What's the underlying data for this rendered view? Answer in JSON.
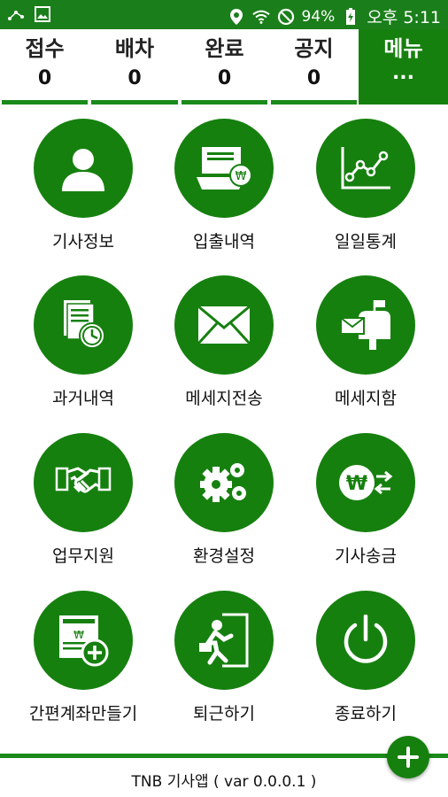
{
  "status_bar": {
    "battery": "94%",
    "time": "오후 5:11",
    "icons": [
      "signal-app-icon",
      "image-icon",
      "location-icon",
      "wifi-icon",
      "do-not-disturb-icon",
      "battery-charging-icon"
    ]
  },
  "tabs": [
    {
      "label": "접수",
      "count": "0"
    },
    {
      "label": "배차",
      "count": "0"
    },
    {
      "label": "완료",
      "count": "0"
    },
    {
      "label": "공지",
      "count": "0"
    },
    {
      "label": "메뉴",
      "count": "..."
    }
  ],
  "menu": [
    {
      "label": "기사정보",
      "icon": "person-icon"
    },
    {
      "label": "입출내역",
      "icon": "bill-won-icon"
    },
    {
      "label": "일일통계",
      "icon": "line-chart-icon"
    },
    {
      "label": "과거내역",
      "icon": "document-history-icon"
    },
    {
      "label": "메세지전송",
      "icon": "envelope-icon"
    },
    {
      "label": "메세지함",
      "icon": "mailbox-icon"
    },
    {
      "label": "업무지원",
      "icon": "handshake-icon"
    },
    {
      "label": "환경설정",
      "icon": "gears-icon"
    },
    {
      "label": "기사송금",
      "icon": "won-transfer-icon"
    },
    {
      "label": "간편계좌만들기",
      "icon": "account-add-icon"
    },
    {
      "label": "퇴근하기",
      "icon": "exit-door-icon"
    },
    {
      "label": "종료하기",
      "icon": "power-icon"
    }
  ],
  "footer": {
    "text": "TNB 기사앱 ( var 0.0.0.1 )"
  },
  "colors": {
    "primary": "#16800f",
    "accent_bar": "#1a8a1a",
    "background": "#ffffff"
  }
}
